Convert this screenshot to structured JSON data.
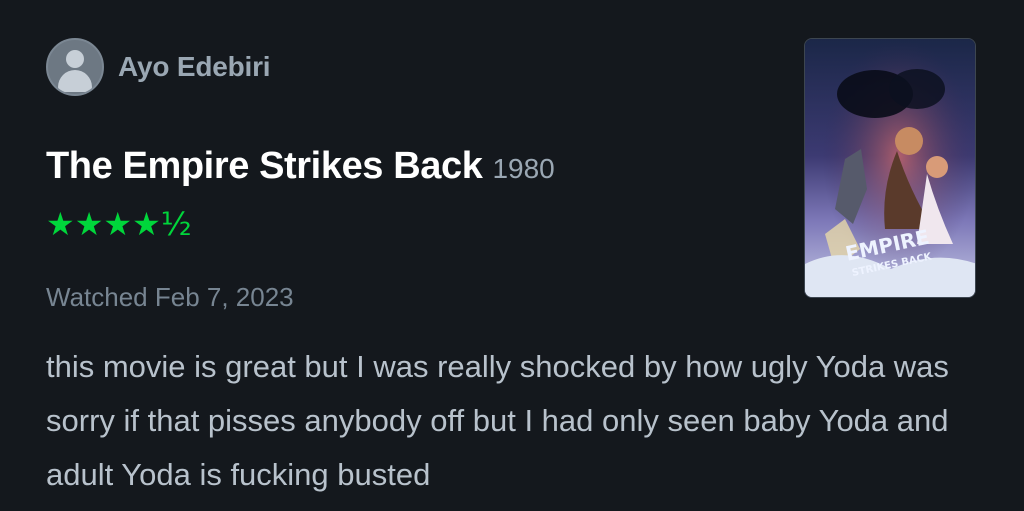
{
  "author": {
    "name": "Ayo Edebiri",
    "avatar_icon": "user-avatar-icon"
  },
  "film": {
    "title": "The Empire Strikes Back",
    "year": "1980",
    "poster_text_line1": "EMPIRE",
    "poster_text_line2": "STRIKES BACK"
  },
  "rating": {
    "display": "★★★★½",
    "value": 4.5,
    "max": 5,
    "color": "#00d63b"
  },
  "watched_label": "Watched Feb 7, 2023",
  "review": {
    "text": "this movie is great but I was really shocked by how ugly Yoda was sorry if that pisses anybody off but I had only seen baby Yoda and adult Yoda is fucking busted"
  },
  "colors": {
    "background": "#14181d",
    "title": "#ffffff",
    "muted": "#9aa7b3",
    "body": "#b8c2cc",
    "accent": "#00d63b"
  }
}
